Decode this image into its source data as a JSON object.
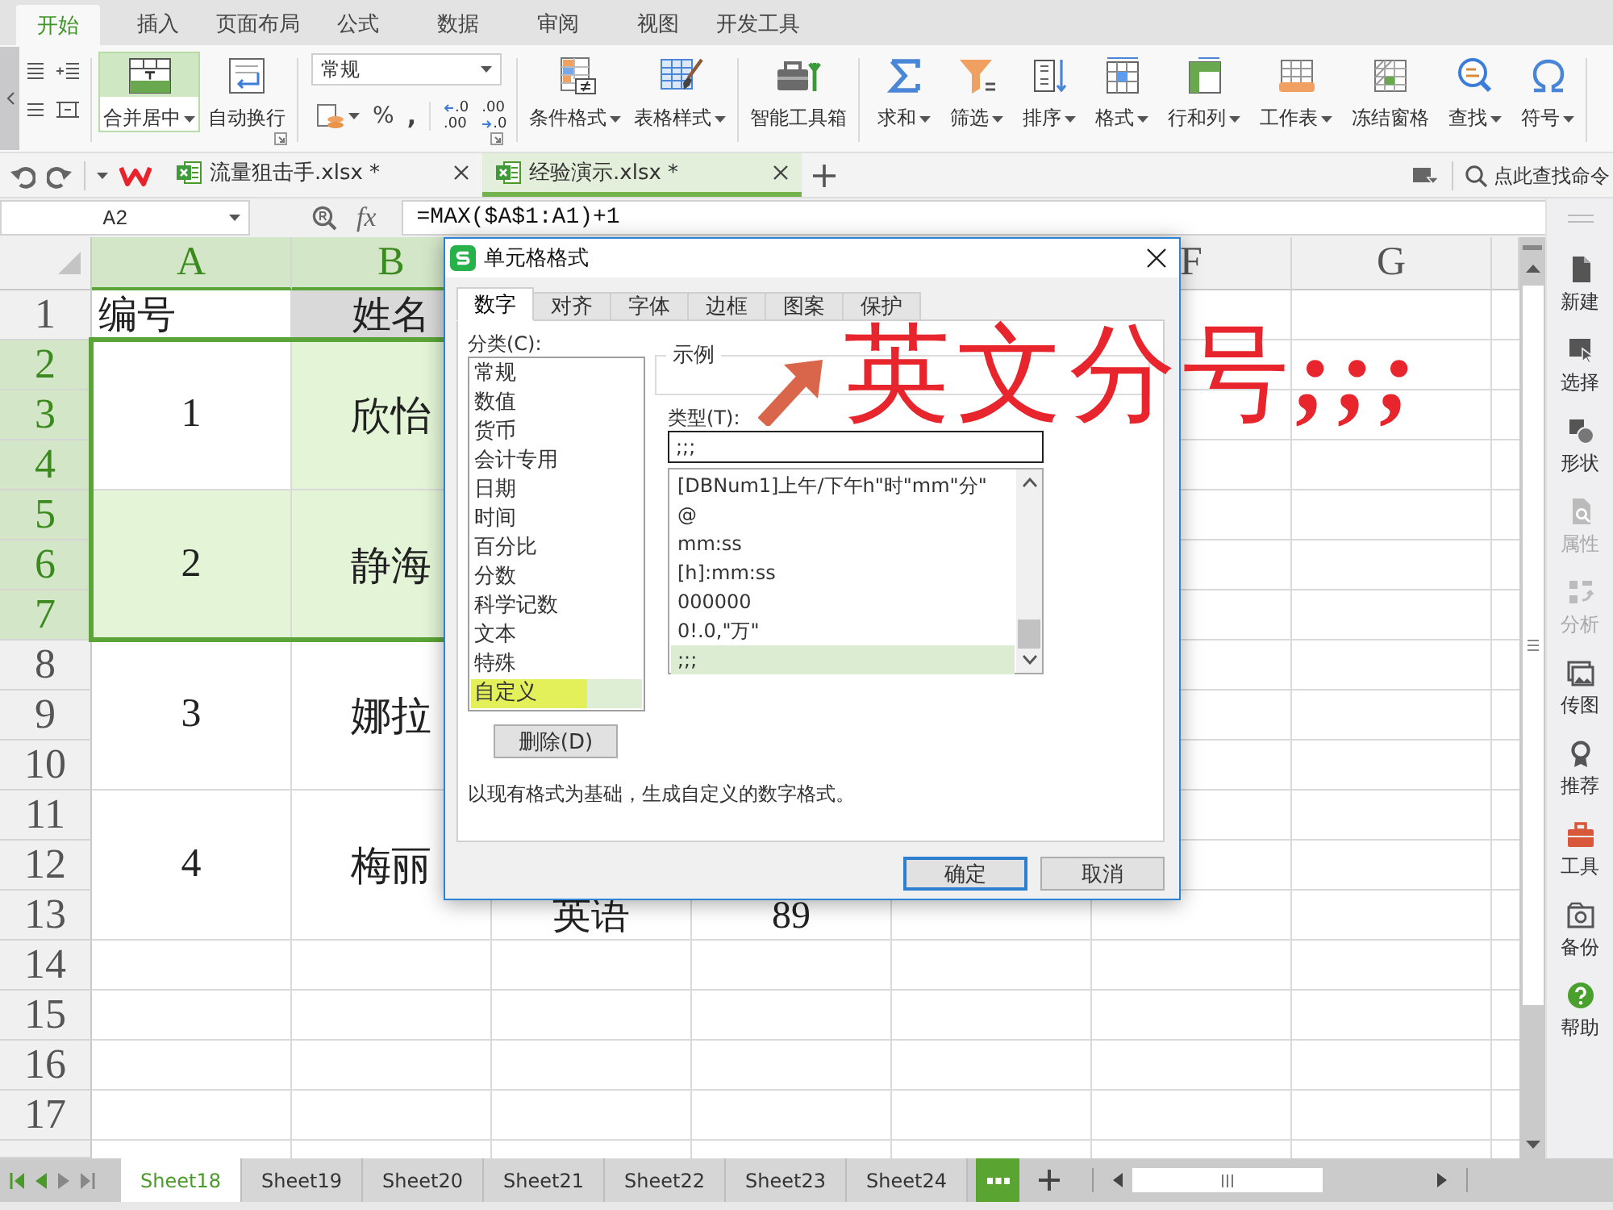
{
  "menu_tabs": [
    {
      "label": "开始",
      "selected": true
    },
    {
      "label": "插入",
      "selected": false
    },
    {
      "label": "页面布局",
      "selected": false
    },
    {
      "label": "公式",
      "selected": false
    },
    {
      "label": "数据",
      "selected": false
    },
    {
      "label": "审阅",
      "selected": false
    },
    {
      "label": "视图",
      "selected": false
    },
    {
      "label": "开发工具",
      "selected": false
    }
  ],
  "ribbon": {
    "merge_wrap": [
      {
        "label": "合并居中",
        "has_menu": true,
        "selected": true
      },
      {
        "label": "自动换行",
        "has_menu": false,
        "selected": false
      }
    ],
    "number_format": {
      "value": "常规",
      "percent": "%",
      "comma": ",",
      "increase_decimal": [
        ".0",
        ".00"
      ],
      "decrease_decimal": [
        ".00",
        ".0"
      ]
    },
    "styles": [
      {
        "label": "条件格式",
        "has_menu": true
      },
      {
        "label": "表格样式",
        "has_menu": true
      }
    ],
    "toolbox": [
      {
        "label": "智能工具箱",
        "has_menu": false
      }
    ],
    "editing": [
      {
        "label": "求和",
        "has_menu": true
      },
      {
        "label": "筛选",
        "has_menu": true
      },
      {
        "label": "排序",
        "has_menu": true
      },
      {
        "label": "格式",
        "has_menu": true
      },
      {
        "label": "行和列",
        "has_menu": true
      },
      {
        "label": "工作表",
        "has_menu": true
      },
      {
        "label": "冻结窗格",
        "has_menu": false
      },
      {
        "label": "查找",
        "has_menu": true
      },
      {
        "label": "符号",
        "has_menu": true
      }
    ]
  },
  "doc_tabs": [
    {
      "label": "流量狙击手.xlsx *",
      "selected": false
    },
    {
      "label": "经验演示.xlsx *",
      "selected": true
    }
  ],
  "command_search": {
    "placeholder": "点此查找命令"
  },
  "formula_bar": {
    "cell": "A2",
    "function_label": "fx",
    "formula": "=MAX($A$1:A1)+1"
  },
  "sheet": {
    "columns": [
      {
        "label": "A",
        "selected": true
      },
      {
        "label": "B",
        "selected": true
      },
      {},
      {},
      {},
      {
        "label": "F",
        "selected": false
      },
      {
        "label": "G",
        "selected": false
      }
    ],
    "rows": [
      {
        "label": "1",
        "selected": false,
        "cells": [
          {
            "text": "编号",
            "kind": "left",
            "selected": false,
            "active": false,
            "shaded": false
          },
          {
            "text": "姓名",
            "kind": "centered",
            "selected": false,
            "active": false,
            "shaded": true
          }
        ]
      },
      {
        "label": "2",
        "selected": true,
        "cells": [
          {
            "text": "1",
            "kind": "centered",
            "selected": true,
            "active": true,
            "shaded": false
          },
          {
            "text": "欣怡",
            "kind": "centered",
            "selected": true,
            "active": false,
            "shaded": false
          }
        ]
      },
      {
        "label": "3",
        "selected": true,
        "cells": [
          {
            "merged_up": true
          },
          {
            "merged_up": true
          }
        ]
      },
      {
        "label": "4",
        "selected": true,
        "cells": [
          {
            "merged_up": true
          },
          {
            "merged_up": true
          }
        ]
      },
      {
        "label": "5",
        "selected": true,
        "cells": [
          {
            "text": "2",
            "kind": "centered",
            "selected": true,
            "active": false,
            "shaded": false
          },
          {
            "text": "静海",
            "kind": "centered",
            "selected": true,
            "active": false,
            "shaded": false
          }
        ]
      },
      {
        "label": "6",
        "selected": true,
        "cells": [
          {
            "merged_up": true
          },
          {
            "merged_up": true
          }
        ]
      },
      {
        "label": "7",
        "selected": true,
        "cells": [
          {
            "merged_up": true
          },
          {
            "merged_up": true
          }
        ]
      },
      {
        "label": "8",
        "selected": false,
        "cells": [
          {
            "text": "3",
            "kind": "centered",
            "selected": false,
            "active": false,
            "shaded": false
          },
          {
            "text": "娜拉",
            "kind": "centered",
            "selected": false,
            "active": false,
            "shaded": false
          }
        ]
      },
      {
        "label": "9",
        "selected": false,
        "cells": [
          {
            "merged_up": true
          },
          {
            "merged_up": true
          }
        ]
      },
      {
        "label": "10",
        "selected": false,
        "cells": [
          {
            "merged_up": true
          },
          {
            "merged_up": true
          }
        ]
      },
      {
        "label": "11",
        "selected": false,
        "cells": [
          {
            "text": "4",
            "kind": "centered",
            "selected": false,
            "active": false,
            "shaded": false
          },
          {
            "text": "梅丽",
            "kind": "centered",
            "selected": false,
            "active": false,
            "shaded": false
          }
        ]
      },
      {
        "label": "12",
        "selected": false,
        "cells": [
          {
            "merged_up": true
          },
          {
            "merged_up": true
          }
        ]
      },
      {
        "label": "13",
        "selected": false,
        "cells": [
          {
            "merged_up": true
          },
          {
            "merged_up": true
          },
          {
            "text": "英语",
            "kind": "centered",
            "selected": false,
            "active": false,
            "shaded": false
          },
          {
            "text": "89",
            "kind": "centered",
            "selected": false,
            "active": false,
            "shaded": false
          }
        ]
      },
      {
        "label": "14",
        "selected": false
      },
      {
        "label": "15",
        "selected": false
      },
      {
        "label": "16",
        "selected": false
      },
      {
        "label": "17",
        "selected": false
      }
    ]
  },
  "dialog": {
    "title": "单元格格式",
    "tabs": [
      {
        "label": "数字",
        "selected": true
      },
      {
        "label": "对齐",
        "selected": false
      },
      {
        "label": "字体",
        "selected": false
      },
      {
        "label": "边框",
        "selected": false
      },
      {
        "label": "图案",
        "selected": false
      },
      {
        "label": "保护",
        "selected": false
      }
    ],
    "category_label": "分类(C):",
    "categories": [
      {
        "label": "常规",
        "selected": false,
        "highlighted": false
      },
      {
        "label": "数值",
        "selected": false,
        "highlighted": false
      },
      {
        "label": "货币",
        "selected": false,
        "highlighted": false
      },
      {
        "label": "会计专用",
        "selected": false,
        "highlighted": false
      },
      {
        "label": "日期",
        "selected": false,
        "highlighted": false
      },
      {
        "label": "时间",
        "selected": false,
        "highlighted": false
      },
      {
        "label": "百分比",
        "selected": false,
        "highlighted": false
      },
      {
        "label": "分数",
        "selected": false,
        "highlighted": false
      },
      {
        "label": "科学记数",
        "selected": false,
        "highlighted": false
      },
      {
        "label": "文本",
        "selected": false,
        "highlighted": false
      },
      {
        "label": "特殊",
        "selected": false,
        "highlighted": false
      },
      {
        "label": "自定义",
        "selected": true,
        "highlighted": true
      }
    ],
    "delete_button": "删除(D)",
    "sample_label": "示例",
    "type_label": "类型(T):",
    "type_value": ";;;",
    "formats": [
      {
        "label": "[DBNum1]上午/下午h\"时\"mm\"分\"",
        "selected": false
      },
      {
        "label": "@",
        "selected": false
      },
      {
        "label": "mm:ss",
        "selected": false
      },
      {
        "label": "[h]:mm:ss",
        "selected": false
      },
      {
        "label": "000000",
        "selected": false
      },
      {
        "label": "0!.0,\"万\"",
        "selected": false
      },
      {
        "label": ";;;",
        "selected": true
      }
    ],
    "description": "以现有格式为基础，生成自定义的数字格式。",
    "buttons": [
      {
        "label": "确定",
        "default": true
      },
      {
        "label": "取消",
        "default": false
      }
    ]
  },
  "annotation": {
    "text": "英文分号**;;;**"
  },
  "sidebar": [
    {
      "label": "新建",
      "disabled": false
    },
    {
      "label": "选择",
      "disabled": false
    },
    {
      "label": "形状",
      "disabled": false
    },
    {
      "label": "属性",
      "disabled": true
    },
    {
      "label": "分析",
      "disabled": true
    },
    {
      "label": "传图",
      "disabled": false
    },
    {
      "label": "推荐",
      "disabled": false
    },
    {
      "label": "工具",
      "disabled": false
    },
    {
      "label": "备份",
      "disabled": false
    },
    {
      "label": "帮助",
      "disabled": false
    }
  ],
  "sheet_tabs": [
    {
      "label": "Sheet18",
      "selected": true
    },
    {
      "label": "Sheet19",
      "selected": false
    },
    {
      "label": "Sheet20",
      "selected": false
    },
    {
      "label": "Sheet21",
      "selected": false
    },
    {
      "label": "Sheet22",
      "selected": false
    },
    {
      "label": "Sheet23",
      "selected": false
    },
    {
      "label": "Sheet24",
      "selected": false
    }
  ]
}
